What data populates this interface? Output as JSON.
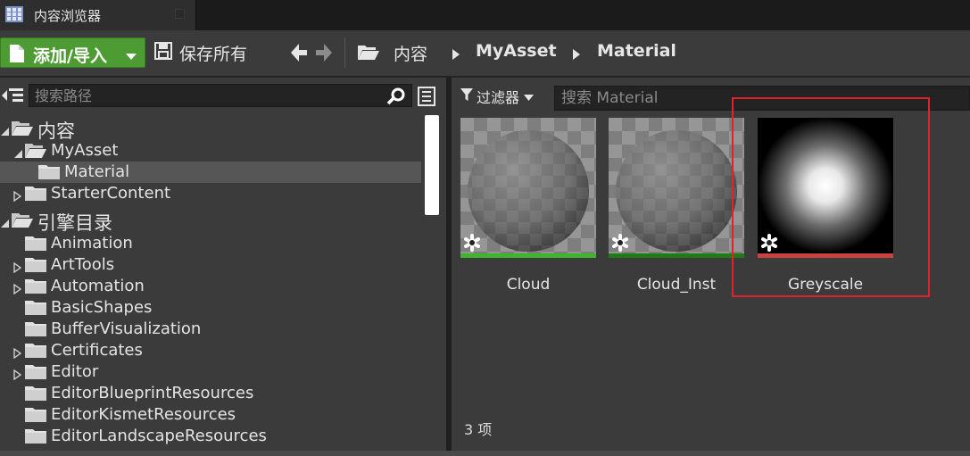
{
  "window": {
    "tab_title": "内容浏览器"
  },
  "toolbar": {
    "add_import_label": "添加/导入",
    "save_all_label": "保存所有",
    "breadcrumb": [
      "内容",
      "MyAsset",
      "Material"
    ]
  },
  "sources": {
    "search_placeholder": "搜索路径",
    "tree": [
      {
        "label": "内容",
        "expanded": true,
        "level": 0
      },
      {
        "label": "MyAsset",
        "expanded": true,
        "level": 1
      },
      {
        "label": "Material",
        "selected": true,
        "level": 2
      },
      {
        "label": "StarterContent",
        "expanded": false,
        "level": 1
      },
      {
        "label": "引擎目录",
        "expanded": true,
        "level": 0
      },
      {
        "label": "Animation",
        "level": 1
      },
      {
        "label": "ArtTools",
        "expanded": false,
        "level": 1
      },
      {
        "label": "Automation",
        "expanded": false,
        "level": 1
      },
      {
        "label": "BasicShapes",
        "level": 1
      },
      {
        "label": "BufferVisualization",
        "level": 1
      },
      {
        "label": "Certificates",
        "expanded": false,
        "level": 1
      },
      {
        "label": "Editor",
        "expanded": false,
        "level": 1
      },
      {
        "label": "EditorBlueprintResources",
        "level": 1
      },
      {
        "label": "EditorKismetResources",
        "level": 1
      },
      {
        "label": "EditorLandscapeResources",
        "level": 1
      }
    ]
  },
  "assets": {
    "filter_label": "过滤器",
    "search_placeholder": "搜索 Material",
    "items": [
      {
        "name": "Cloud",
        "thumbnail": "checker-sphere",
        "bar_color": "#3fb52b"
      },
      {
        "name": "Cloud_Inst",
        "thumbnail": "checker-sphere",
        "bar_color": "#1f7a17"
      },
      {
        "name": "Greyscale",
        "thumbnail": "radial-glow",
        "bar_color": "#c9423f"
      }
    ],
    "item_count": "3 项"
  },
  "colors": {
    "accent_green": "#4d9b33",
    "highlight_red": "#e0232a"
  }
}
